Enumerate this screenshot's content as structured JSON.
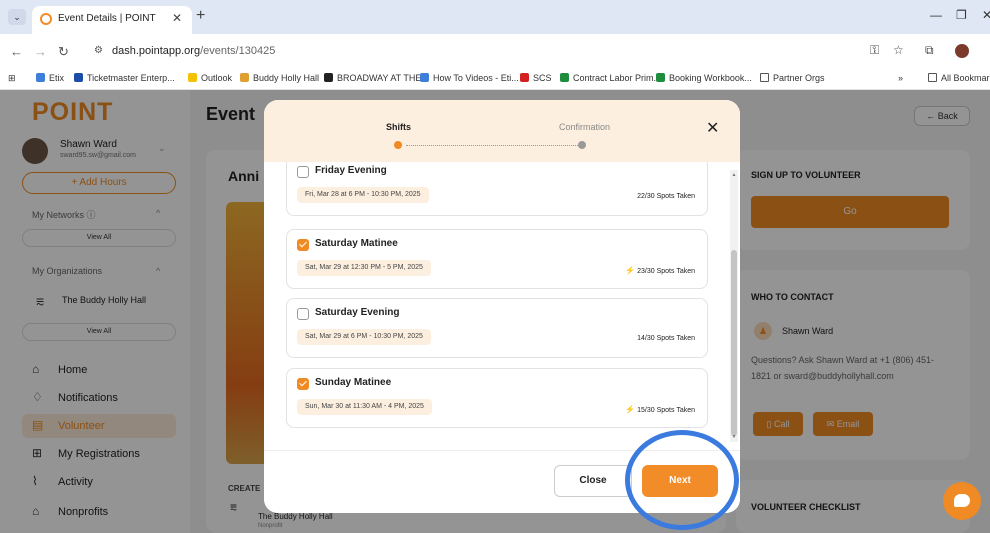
{
  "browser": {
    "tab_title": "Event Details | POINT",
    "tab_close": "✕",
    "new_tab": "+",
    "url_host": "dash.pointapp.org",
    "url_path": "/events/130425",
    "bookmarks": [
      {
        "label": "Etix",
        "color": "#3f7fdc"
      },
      {
        "label": "Ticketmaster Enterp...",
        "color": "#1c4ea8"
      },
      {
        "label": "Outlook",
        "color": "#f2c100"
      },
      {
        "label": "Buddy Holly Hall",
        "color": "#e0a030"
      },
      {
        "label": "BROADWAY AT THE...",
        "color": "#222222"
      },
      {
        "label": "How To Videos - Eti...",
        "color": "#3f7fdc"
      },
      {
        "label": "SCS",
        "color": "#d42020"
      },
      {
        "label": "Contract Labor Prim...",
        "color": "#1e8e3e"
      },
      {
        "label": "Booking Workbook...",
        "color": "#1e8e3e"
      },
      {
        "label": "Partner Orgs",
        "color": "#555555"
      }
    ],
    "all_bookmarks": "All Bookmarks"
  },
  "sidebar": {
    "logo": "POINT",
    "user_name": "Shawn Ward",
    "user_email": "sward95.sw@gmail.com",
    "add_hours": "+ Add Hours",
    "my_networks": "My Networks ⓘ",
    "view_all": "View All",
    "my_organizations": "My Organizations",
    "org_name": "The Buddy Holly Hall",
    "nav": [
      {
        "label": "Home",
        "icon": "⌂"
      },
      {
        "label": "Notifications",
        "icon": "♢"
      },
      {
        "label": "Volunteer",
        "icon": "▤"
      },
      {
        "label": "My Registrations",
        "icon": "⊞"
      },
      {
        "label": "Activity",
        "icon": "⌇"
      },
      {
        "label": "Nonprofits",
        "icon": "⌂"
      }
    ]
  },
  "main": {
    "title": "Event",
    "event_title": "Anni",
    "back": "← Back",
    "created_label": "CREATE",
    "org_name": "The Buddy Holly Hall",
    "org_sub": "Nonprofit",
    "signup_title": "SIGN UP TO VOLUNTEER",
    "go": "Go",
    "contact_title": "WHO TO CONTACT",
    "contact_name": "Shawn Ward",
    "contact_question": "Questions? Ask Shawn Ward at +1 (806) 451-1821 or sward@buddyhollyhall.com",
    "call": "Call",
    "email": "Email",
    "checklist_title": "VOLUNTEER CHECKLIST"
  },
  "modal": {
    "step1": "Shifts",
    "step2": "Confirmation",
    "close_x": "✕",
    "shifts": [
      {
        "name": "Friday Evening",
        "date": "Fri, Mar 28 at 6 PM - 10:30 PM, 2025",
        "spots": "22/30 Spots Taken",
        "checked": false,
        "bolt": false
      },
      {
        "name": "Saturday Matinee",
        "date": "Sat, Mar 29 at 12:30 PM - 5 PM, 2025",
        "spots": "23/30 Spots Taken",
        "checked": true,
        "bolt": true
      },
      {
        "name": "Saturday Evening",
        "date": "Sat, Mar 29 at 6 PM - 10:30 PM, 2025",
        "spots": "14/30 Spots Taken",
        "checked": false,
        "bolt": false
      },
      {
        "name": "Sunday Matinee",
        "date": "Sun, Mar 30 at 11:30 AM - 4 PM, 2025",
        "spots": "15/30 Spots Taken",
        "checked": true,
        "bolt": true
      }
    ],
    "close_button": "Close",
    "next_button": "Next"
  },
  "colors": {
    "accent": "#f08a24",
    "highlight_ring": "#3b7be0"
  }
}
